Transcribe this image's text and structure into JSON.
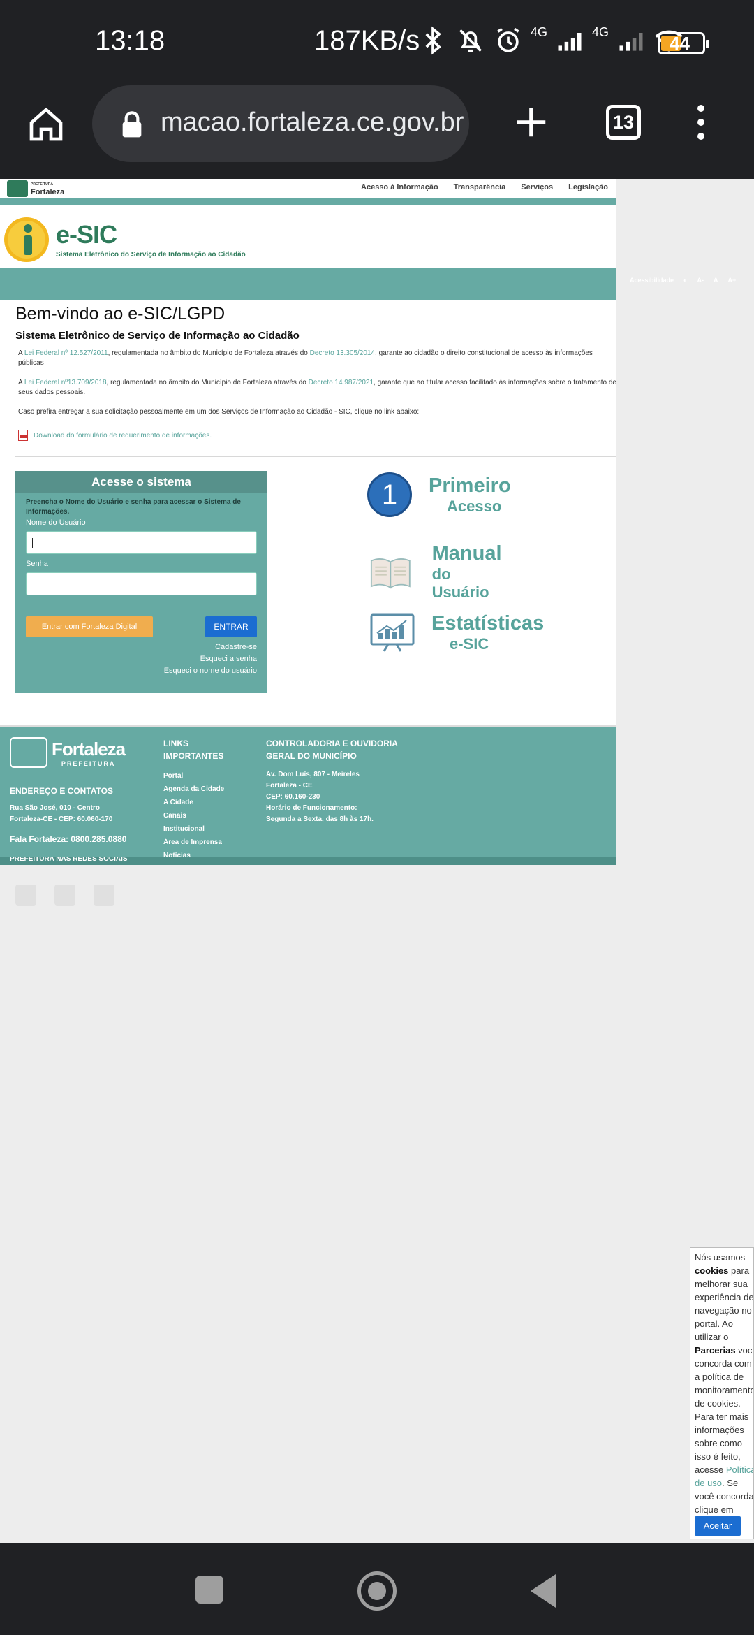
{
  "status_bar": {
    "time": "13:18",
    "speed": "187KB/s",
    "network1": "4G",
    "network2": "4G",
    "battery": "44"
  },
  "browser": {
    "url": "macao.fortaleza.ce.gov.br",
    "tab_count": "13"
  },
  "site": {
    "header_logo": {
      "small": "PREFEITURA",
      "name": "Fortaleza"
    },
    "top_links": [
      "Acesso à Informação",
      "Transparência",
      "Serviços",
      "Legislação"
    ],
    "esic_title": "e-SIC",
    "esic_subtitle": "Sistema Eletrônico do Serviço de Informação ao Cidadão",
    "accessibility": {
      "label": "Acessibilidade",
      "a_minus": "A-",
      "a": "A",
      "a_plus": "A+"
    }
  },
  "main": {
    "heading": "Bem-vindo ao e-SIC/LGPD",
    "subheading": "Sistema Eletrônico de Serviço de Informação ao Cidadão",
    "p1": {
      "prefix": "A ",
      "link1": "Lei Federal nº 12.527/2011",
      "middle": ", regulamentada no âmbito do Município de Fortaleza através do ",
      "link2": "Decreto 13.305/2014",
      "suffix": ", garante ao cidadão o direito constitucional de acesso às informações públicas"
    },
    "p2": {
      "prefix": "A ",
      "link1": "Lei Federal nº13.709/2018",
      "middle": ", regulamentada no âmbito do Município de Fortaleza através do ",
      "link2": "Decreto 14.987/2021",
      "suffix": ", garante que ao titular acesso facilitado às informações sobre o tratamento de seus dados pessoais."
    },
    "p3": "Caso prefira entregar a sua solicitação pessoalmente em um dos Serviços de Informação ao Cidadão - SIC, clique no link abaixo:",
    "download": "Download do formulário de requerimento de informações."
  },
  "login": {
    "title": "Acesse o sistema",
    "hint": "Preencha o Nome do Usuário e senha para acessar o Sistema de Informações.",
    "username_label": "Nome do Usuário",
    "username_value": "",
    "password_label": "Senha",
    "password_value": "",
    "btn_fortaleza": "Entrar com Fortaleza Digital",
    "btn_entrar": "ENTRAR",
    "link_register": "Cadastre-se",
    "link_forgot_password": "Esqueci a senha",
    "link_forgot_user": "Esqueci o nome do usuário"
  },
  "side_links": {
    "first_number": "1",
    "first_big": "Primeiro",
    "first_small": "Acesso",
    "manual_big": "Manual",
    "manual_small": "do Usuário",
    "stats_big": "Estatísticas",
    "stats_small": "e-SIC"
  },
  "footer": {
    "logo_name": "Fortaleza",
    "logo_pref": "PREFEITURA",
    "address_heading": "ENDEREÇO E CONTATOS",
    "address_line1": "Rua São José, 010 - Centro",
    "address_line2": "Fortaleza-CE - CEP: 60.060-170",
    "phone": "Fala Fortaleza: 0800.285.0880",
    "links_heading1": "LINKS",
    "links_heading2": "IMPORTANTES",
    "links": [
      "Portal",
      "Agenda da Cidade",
      "A Cidade",
      "Canais",
      "Institucional",
      "Área de Imprensa",
      "Notícias"
    ],
    "cgm_heading1": "CONTROLADORIA E OUVIDORIA",
    "cgm_heading2": "GERAL DO MUNICÍPIO",
    "cgm_lines": [
      "Av. Dom Luís, 807 - Meireles",
      "Fortaleza - CE",
      "CEP: 60.160-230",
      "Horário de Funcionamento:",
      "Segunda a Sexta, das 8h às 17h."
    ],
    "bottom": "PREFEITURA NAS REDES SOCIAIS"
  },
  "cookie": {
    "t1": "Nós usamos ",
    "b1": "cookies",
    "t2": " para melhorar sua experiência de navegação no portal. Ao utilizar o ",
    "b2": "Parcerias",
    "t3": " você concorda com a política de monitoramento de cookies. Para ter mais informações sobre como isso é feito, acesse ",
    "link": "Política de uso",
    "t4": ". Se você concorda, clique em",
    "accept": "Aceitar"
  }
}
